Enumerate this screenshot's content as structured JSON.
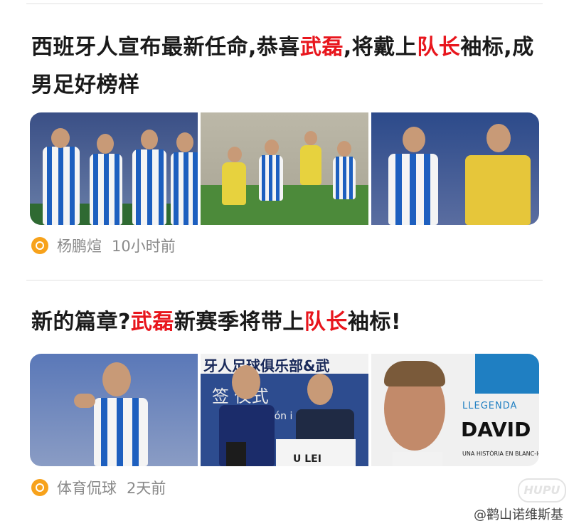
{
  "articles": [
    {
      "title_parts": [
        {
          "text": "西班牙人宣布最新任命,恭喜",
          "highlight": false
        },
        {
          "text": "武磊",
          "highlight": true
        },
        {
          "text": ",将戴上",
          "highlight": false
        },
        {
          "text": "队长",
          "highlight": true
        },
        {
          "text": "袖标,成男足好榜样",
          "highlight": false
        }
      ],
      "images": [
        "players-lineup-photo",
        "match-action-photo",
        "player-reaction-photo"
      ],
      "source": "杨鹏煊",
      "time": "10小时前"
    },
    {
      "title_parts": [
        {
          "text": "新的篇章?",
          "highlight": false
        },
        {
          "text": "武磊",
          "highlight": true
        },
        {
          "text": "新赛季将带上",
          "highlight": false
        },
        {
          "text": "队长",
          "highlight": true
        },
        {
          "text": "袖标!",
          "highlight": false
        }
      ],
      "images": [
        "player-applause-photo",
        "signing-ceremony-photo",
        "legend-poster-photo"
      ],
      "image_texts": {
        "ceremony_banner": "牙人足球俱乐部&武",
        "ceremony_sign": "签 仪式",
        "ceremony_sub": "ción i  EK",
        "shirt": "U LEI",
        "poster_tag": "LLEGENDA",
        "poster_name": "DAVID LÓ",
        "poster_sub": "UNA HISTÒRIA EN BLANC-I-BLAU"
      },
      "source": "体育侃球",
      "time": "2天前"
    }
  ],
  "watermark": {
    "logo": "HUPU",
    "text": "@鹳山诺维斯基"
  },
  "colors": {
    "highlight": "#e8161d",
    "meta_text": "#8a8a8a",
    "source_icon": "#f7a21b"
  }
}
